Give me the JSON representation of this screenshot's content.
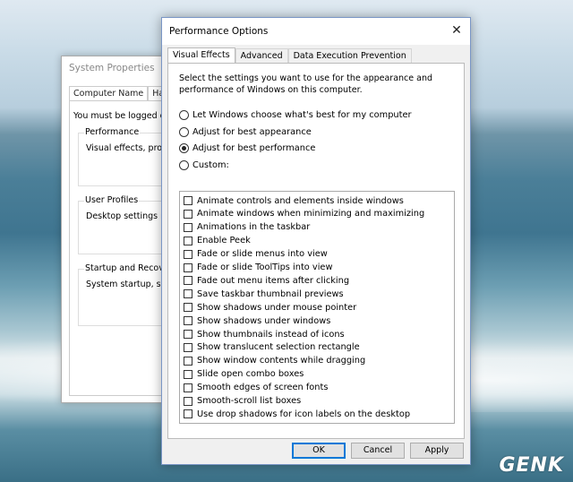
{
  "background_window": {
    "title": "System Properties",
    "tabs": [
      "Computer Name",
      "Hardwa"
    ],
    "message": "You must be logged on",
    "groups": [
      {
        "label": "Performance",
        "description": "Visual effects, process"
      },
      {
        "label": "User Profiles",
        "description": "Desktop settings relat"
      },
      {
        "label": "Startup and Recovery",
        "description": "System startup, system"
      }
    ]
  },
  "dialog": {
    "title": "Performance Options",
    "close_glyph": "✕",
    "tabs": [
      {
        "label": "Visual Effects",
        "active": true
      },
      {
        "label": "Advanced",
        "active": false
      },
      {
        "label": "Data Execution Prevention",
        "active": false
      }
    ],
    "intro": "Select the settings you want to use for the appearance and performance of Windows on this computer.",
    "radios": [
      {
        "label": "Let Windows choose what's best for my computer",
        "selected": false
      },
      {
        "label": "Adjust for best appearance",
        "selected": false
      },
      {
        "label": "Adjust for best performance",
        "selected": true
      },
      {
        "label": "Custom:",
        "selected": false
      }
    ],
    "checkboxes": [
      {
        "label": "Animate controls and elements inside windows",
        "checked": false
      },
      {
        "label": "Animate windows when minimizing and maximizing",
        "checked": false
      },
      {
        "label": "Animations in the taskbar",
        "checked": false
      },
      {
        "label": "Enable Peek",
        "checked": false
      },
      {
        "label": "Fade or slide menus into view",
        "checked": false
      },
      {
        "label": "Fade or slide ToolTips into view",
        "checked": false
      },
      {
        "label": "Fade out menu items after clicking",
        "checked": false
      },
      {
        "label": "Save taskbar thumbnail previews",
        "checked": false
      },
      {
        "label": "Show shadows under mouse pointer",
        "checked": false
      },
      {
        "label": "Show shadows under windows",
        "checked": false
      },
      {
        "label": "Show thumbnails instead of icons",
        "checked": false
      },
      {
        "label": "Show translucent selection rectangle",
        "checked": false
      },
      {
        "label": "Show window contents while dragging",
        "checked": false
      },
      {
        "label": "Slide open combo boxes",
        "checked": false
      },
      {
        "label": "Smooth edges of screen fonts",
        "checked": false
      },
      {
        "label": "Smooth-scroll list boxes",
        "checked": false
      },
      {
        "label": "Use drop shadows for icon labels on the desktop",
        "checked": false
      }
    ],
    "buttons": {
      "ok": "OK",
      "cancel": "Cancel",
      "apply": "Apply"
    }
  },
  "watermark": "GENK"
}
